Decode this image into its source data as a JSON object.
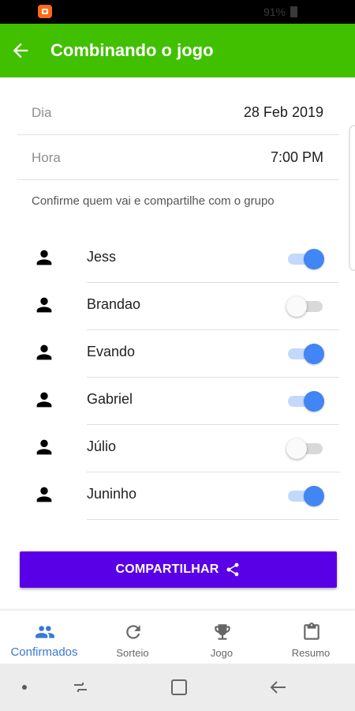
{
  "status_bar": {
    "battery_text": "91%",
    "icons": [
      "app-notification-icon",
      "battery-icon"
    ]
  },
  "app_bar": {
    "title": "Combinando o jogo",
    "back_icon": "arrow-back-icon",
    "color": "#41c000"
  },
  "details": {
    "date_label": "Dia",
    "date_value": "28 Feb 2019",
    "time_label": "Hora",
    "time_value": "7:00 PM"
  },
  "hint": "Confirme quem vai e compartilhe com o grupo",
  "players": [
    {
      "name": "Jess",
      "confirmed": true,
      "icon": "person-icon"
    },
    {
      "name": "Brandao",
      "confirmed": false,
      "icon": "person-icon"
    },
    {
      "name": "Evando",
      "confirmed": true,
      "icon": "person-icon"
    },
    {
      "name": "Gabriel",
      "confirmed": true,
      "icon": "person-icon"
    },
    {
      "name": "Júlio",
      "confirmed": false,
      "icon": "person-icon"
    },
    {
      "name": "Juninho",
      "confirmed": true,
      "icon": "person-icon"
    }
  ],
  "share_button": {
    "label": "COMPARTILHAR",
    "icon": "share-icon",
    "color": "#5a00e6"
  },
  "bottom_nav": [
    {
      "label": "Confirmados",
      "icon": "group-icon",
      "active": true
    },
    {
      "label": "Sorteio",
      "icon": "refresh-icon",
      "active": false
    },
    {
      "label": "Jogo",
      "icon": "trophy-icon",
      "active": false
    },
    {
      "label": "Resumo",
      "icon": "clipboard-icon",
      "active": false
    }
  ],
  "colors": {
    "toggle_on": "#4285f4",
    "nav_active": "#3a78d4"
  }
}
